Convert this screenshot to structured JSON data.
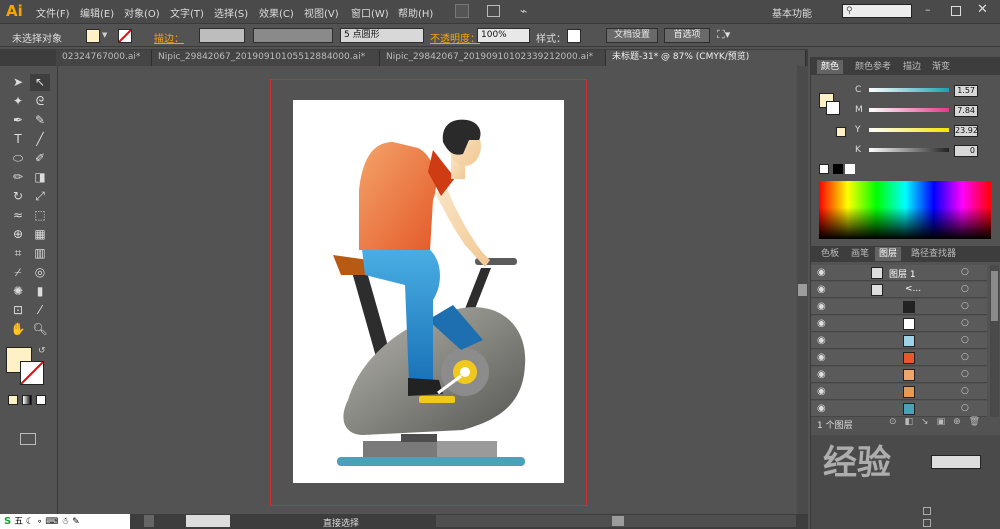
{
  "app": {
    "logo": "Ai"
  },
  "menu": [
    "文件(F)",
    "编辑(E)",
    "对象(O)",
    "文字(T)",
    "选择(S)",
    "效果(C)",
    "视图(V)",
    "窗口(W)",
    "帮助(H)"
  ],
  "workspace": "基本功能",
  "control": {
    "selection": "未选择对象",
    "stroke_label": "描边：",
    "brush": "5 点圆形",
    "opacity_label": "不透明度：",
    "opacity_value": "100%",
    "style_label": "样式：",
    "doc_setup": "文档设置",
    "prefs": "首选项"
  },
  "tabs": [
    "02324767000.ai*",
    "Nipic_29842067_20190910105512884000.ai*",
    "Nipic_29842067_20190910102339212000.ai*",
    "未标题-31* @ 87% (CMYK/预览)"
  ],
  "color_panel": {
    "tabs": [
      "颜色",
      "颜色参考",
      "描边",
      "渐变"
    ],
    "channels": [
      {
        "name": "C",
        "value": "1.57",
        "color": "#19a1b0"
      },
      {
        "name": "M",
        "value": "7.84",
        "color": "#e23a8a"
      },
      {
        "name": "Y",
        "value": "23.92",
        "color": "#f2e600"
      },
      {
        "name": "K",
        "value": "0",
        "color": "#222222"
      }
    ]
  },
  "layer_panel": {
    "tabs": [
      "色板",
      "画笔",
      "图层",
      "路径查找器"
    ],
    "layer_name": "图层 1",
    "group_name": "<...",
    "footer": "1 个图层"
  },
  "status": {
    "zoom": "87%",
    "tool": "直接选择"
  },
  "colors": {
    "fill": "#fff1c6",
    "accent": "#f7a400"
  },
  "watermark": "经验"
}
